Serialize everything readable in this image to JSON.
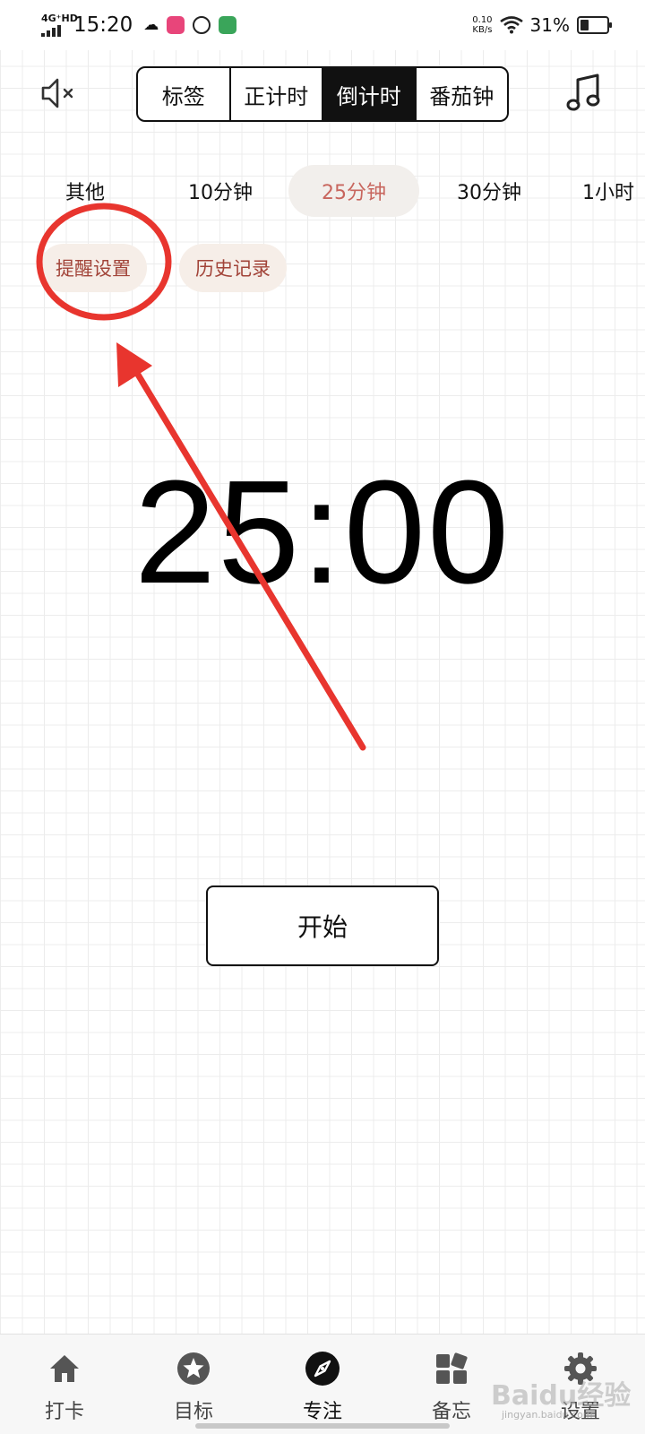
{
  "status_bar": {
    "network": "4G⁺HD",
    "time": "15:20",
    "speed_value": "0.10",
    "speed_unit": "KB/s",
    "battery_pct": "31%",
    "battery_level": 0.31
  },
  "top_bar": {
    "mute_icon": "speaker-mute-icon",
    "music_icon": "music-note-icon",
    "segments": [
      {
        "label": "标签",
        "active": false
      },
      {
        "label": "正计时",
        "active": false
      },
      {
        "label": "倒计时",
        "active": true
      },
      {
        "label": "番茄钟",
        "active": false
      }
    ]
  },
  "presets": [
    {
      "label": "其他",
      "active": false
    },
    {
      "label": "10分钟",
      "active": false
    },
    {
      "label": "25分钟",
      "active": true
    },
    {
      "label": "30分钟",
      "active": false
    },
    {
      "label": "1小时",
      "active": false
    }
  ],
  "actions": {
    "reminder_label": "提醒设置",
    "history_label": "历史记录"
  },
  "timer": {
    "display": "25:00"
  },
  "start_button": {
    "label": "开始"
  },
  "bottom_nav": [
    {
      "label": "打卡",
      "icon": "home-icon",
      "active": false
    },
    {
      "label": "目标",
      "icon": "star-icon",
      "active": false
    },
    {
      "label": "专注",
      "icon": "compass-icon",
      "active": true
    },
    {
      "label": "备忘",
      "icon": "widgets-icon",
      "active": false
    },
    {
      "label": "设置",
      "icon": "gear-icon",
      "active": false
    }
  ],
  "watermark": {
    "text": "Baidu经验",
    "sub": "jingyan.baidu.com"
  },
  "colors": {
    "accent_text": "#c8665e",
    "chip_bg": "#f6eee8",
    "chip_text": "#a24439",
    "annotation": "#e8352e"
  }
}
